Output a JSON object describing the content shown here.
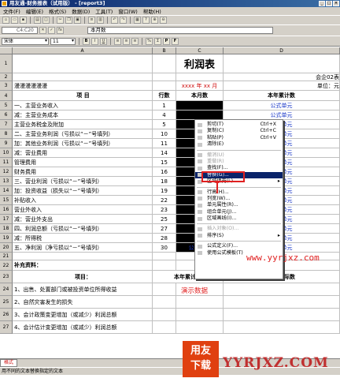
{
  "titlebar": {
    "title": "用友通-财务报表（试用版） - [report3]"
  },
  "menu": [
    "文件(F)",
    "编辑(E)",
    "格式(S)",
    "数据(D)",
    "工具(T)",
    "窗口(W)",
    "帮助(H)"
  ],
  "formula": {
    "cell_ref": "C4:C20",
    "content": "本月数"
  },
  "format": {
    "font": "宋体",
    "size": "11"
  },
  "toolbar_labels": {
    "bold": "B",
    "italic": "I",
    "underline": "U",
    "percent": "%",
    "sum": "Σ",
    "pi": "P",
    "pf": "F",
    "fx": "fx",
    "sort": "S",
    "question": "?"
  },
  "columns": [
    "A",
    "B",
    "C",
    "D"
  ],
  "rows": [
    {
      "n": "1",
      "a": "",
      "b": "",
      "c": "利润表",
      "d": ""
    },
    {
      "n": "2",
      "a": "",
      "b": "",
      "c": "",
      "d": "会企02表"
    },
    {
      "n": "3",
      "a": "漫漫漫漫漫漫",
      "b": "",
      "c": "xxxx 年   xx 月",
      "d": "单位：元"
    },
    {
      "n": "4",
      "a": "项        目",
      "b": "行数",
      "c": "本月数",
      "d": "本年累计数"
    },
    {
      "n": "5",
      "a": "一、主营业务收入",
      "b": "1",
      "c": "",
      "d": "公式单元"
    },
    {
      "n": "6",
      "a": "    减：主营业务成本",
      "b": "4",
      "c": "",
      "d": "公式单元"
    },
    {
      "n": "7",
      "a": "        主营业务税金及附加",
      "b": "5",
      "c": "",
      "d": "公式单元"
    },
    {
      "n": "8",
      "a": "二、主营业务利润（亏损以“－”号填列）",
      "b": "10",
      "c": "",
      "d": "公式单元"
    },
    {
      "n": "9",
      "a": "    加：其他业务利润（亏损以“－”号填列）",
      "b": "11",
      "c": "",
      "d": "公式单元"
    },
    {
      "n": "10",
      "a": "    减：营业费用",
      "b": "14",
      "c": "",
      "d": "公式单元"
    },
    {
      "n": "11",
      "a": "        管理费用",
      "b": "15",
      "c": "",
      "d": "公式单元"
    },
    {
      "n": "12",
      "a": "        财务费用",
      "b": "16",
      "c": "",
      "d": "公式单元"
    },
    {
      "n": "13",
      "a": "三、营业利润（亏损以“－”号填列）",
      "b": "18",
      "c": "",
      "d": "公式单元"
    },
    {
      "n": "14",
      "a": "    加：投资收益（损失以“－”号填列）",
      "b": "19",
      "c": "",
      "d": "公式单元"
    },
    {
      "n": "15",
      "a": "        补贴收入",
      "b": "22",
      "c": "",
      "d": "公式单元"
    },
    {
      "n": "16",
      "a": "        营业外收入",
      "b": "23",
      "c": "",
      "d": "公式单元"
    },
    {
      "n": "17",
      "a": "    减：营业外支出",
      "b": "25",
      "c": "",
      "d": "公式单元"
    },
    {
      "n": "18",
      "a": "四、利润总额（亏损以“－”号填列）",
      "b": "27",
      "c": "",
      "d": "公式单元"
    },
    {
      "n": "19",
      "a": "    减：所得税",
      "b": "28",
      "c": "",
      "d": "公式单元"
    },
    {
      "n": "20",
      "a": "五、净利润（净亏损以“－”号填列）",
      "b": "30",
      "c": "公式单元",
      "d": "公式单元"
    },
    {
      "n": "21",
      "a": "",
      "b": "",
      "c": "",
      "d": ""
    },
    {
      "n": "22",
      "a": "补充资料：",
      "b": "",
      "c": "",
      "d": ""
    },
    {
      "n": "23",
      "a": "项目：",
      "b": "本年累计数",
      "c": "",
      "d": "上年实际数"
    },
    {
      "n": "24",
      "a": "1、出售、处置部门或被投资单位所得收益",
      "b": "",
      "c": "",
      "d": ""
    },
    {
      "n": "25",
      "a": "2、自然灾害发生的损失",
      "b": "",
      "c": "",
      "d": ""
    },
    {
      "n": "26",
      "a": "3、会计政策变更增加（或减少）利润总额",
      "b": "",
      "c": "",
      "d": ""
    },
    {
      "n": "27",
      "a": "4、会计估计变更增加（或减少）利润总额",
      "b": "",
      "c": "",
      "d": ""
    }
  ],
  "context_menu": [
    {
      "label": "剪切(T)",
      "shortcut": "Ctrl+X",
      "disabled": false
    },
    {
      "label": "复制(C)",
      "shortcut": "Ctrl+C",
      "disabled": false
    },
    {
      "label": "粘贴(P)",
      "shortcut": "Ctrl+V",
      "disabled": false
    },
    {
      "label": "清除(E)",
      "shortcut": "",
      "disabled": false
    },
    {
      "sep": true
    },
    {
      "label": "撤消(U)",
      "shortcut": "",
      "disabled": true
    },
    {
      "label": "重做(R)",
      "shortcut": "",
      "disabled": true
    },
    {
      "label": "查找(F)...",
      "shortcut": "",
      "disabled": false
    },
    {
      "label": "替换(G)...",
      "shortcut": "",
      "disabled": false,
      "highlight": true
    },
    {
      "label": "区域填充(L)",
      "shortcut": "",
      "disabled": false,
      "arrow": true
    },
    {
      "sep": true
    },
    {
      "label": "行高(H)...",
      "shortcut": "",
      "disabled": false
    },
    {
      "label": "列宽(W)...",
      "shortcut": "",
      "disabled": false
    },
    {
      "label": "单元属性(R)...",
      "shortcut": "",
      "disabled": false
    },
    {
      "label": "组合单元(J)...",
      "shortcut": "",
      "disabled": false
    },
    {
      "label": "区域画线(I)...",
      "shortcut": "",
      "disabled": false
    },
    {
      "sep": true
    },
    {
      "label": "插入对象(O)...",
      "shortcut": "",
      "disabled": true
    },
    {
      "label": "排序(S)",
      "shortcut": "",
      "disabled": false,
      "arrow": true
    },
    {
      "sep": true
    },
    {
      "label": "公式定义(F)...",
      "shortcut": "",
      "disabled": false
    },
    {
      "label": "使用公式模板(T)",
      "shortcut": "",
      "disabled": false
    }
  ],
  "annotation": {
    "demo_label": "演示数据"
  },
  "sheet_tab": "格式",
  "status": "用不同的文本替换指定的文本",
  "watermark": {
    "box_line1": "用友",
    "box_line2": "下载",
    "text": "YYRJXZ.COM",
    "url": "www.yyrjxz.com"
  },
  "colors": {
    "titlebar": "#0a246a",
    "highlight": "#0a246a",
    "formula_cell": "#1a38c8",
    "annotation": "#e02020"
  }
}
